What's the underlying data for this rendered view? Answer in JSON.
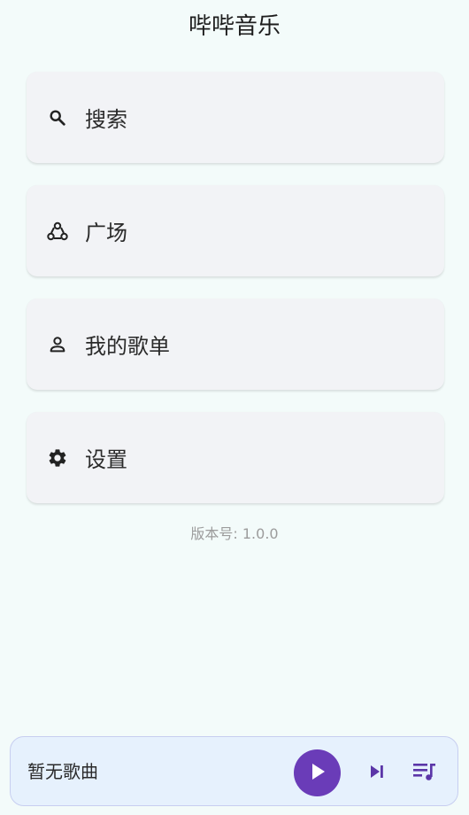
{
  "app": {
    "title": "哔哔音乐"
  },
  "menu": {
    "items": [
      {
        "label": "搜索",
        "icon": "search-icon"
      },
      {
        "label": "广场",
        "icon": "community-icon"
      },
      {
        "label": "我的歌单",
        "icon": "person-icon"
      },
      {
        "label": "设置",
        "icon": "gear-icon"
      }
    ]
  },
  "footer": {
    "version": "版本号: 1.0.0"
  },
  "player": {
    "song": "暂无歌曲",
    "play_icon": "play-icon",
    "next_icon": "skip-next-icon",
    "queue_icon": "queue-music-icon"
  },
  "colors": {
    "background": "#f3fbfa",
    "card": "#f2f3f6",
    "accent": "#6a3cb8",
    "player_bg": "#e6f1fd"
  }
}
